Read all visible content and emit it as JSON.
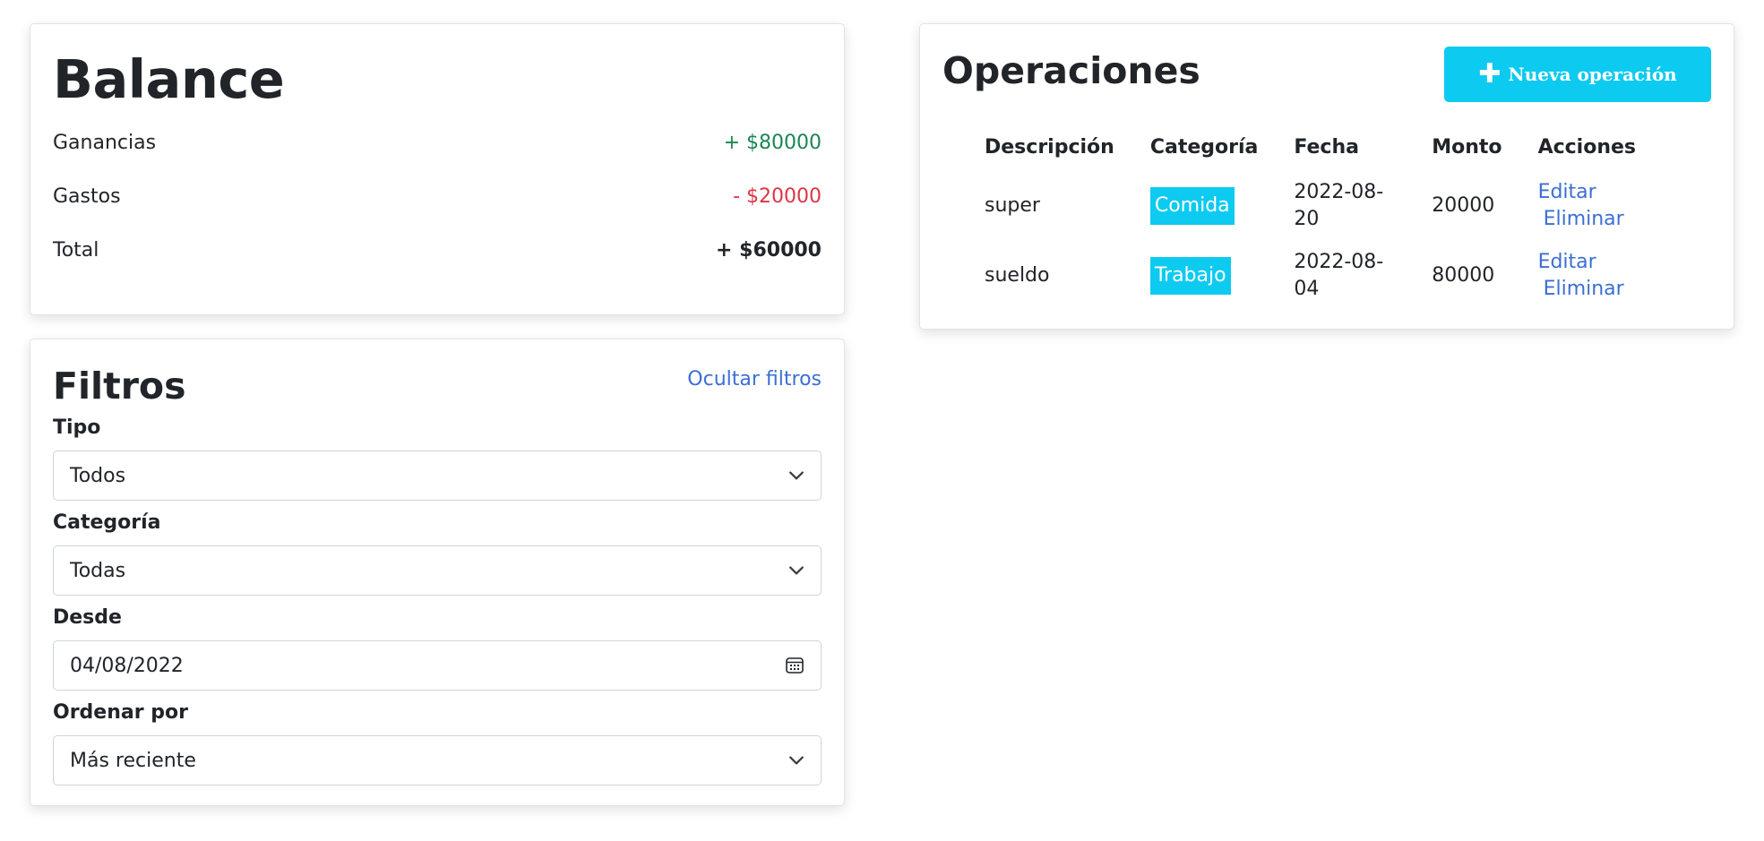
{
  "balance": {
    "title": "Balance",
    "rows": [
      {
        "label": "Ganancias",
        "value": "+ $80000"
      },
      {
        "label": "Gastos",
        "value": "- $20000"
      },
      {
        "label": "Total",
        "value": "+ $60000"
      }
    ]
  },
  "filters": {
    "title": "Filtros",
    "toggle_label": "Ocultar filtros",
    "fields": [
      {
        "label": "Tipo",
        "value": "Todos"
      },
      {
        "label": "Categoría",
        "value": "Todas"
      },
      {
        "label": "Desde",
        "value": "04/08/2022"
      },
      {
        "label": "Ordenar por",
        "value": "Más reciente"
      }
    ]
  },
  "operations": {
    "title": "Operaciones",
    "new_button_label": "Nueva operación",
    "columns": [
      "Descripción",
      "Categoría",
      "Fecha",
      "Monto",
      "Acciones"
    ],
    "rows": [
      {
        "description": "super",
        "category": "Comida",
        "date": "2022-08-20",
        "amount": "20000",
        "edit": "Editar",
        "delete": "Eliminar"
      },
      {
        "description": "sueldo",
        "category": "Trabajo",
        "date": "2022-08-04",
        "amount": "80000",
        "edit": "Editar",
        "delete": "Eliminar"
      }
    ]
  },
  "colors": {
    "accent": "#0dcaf0",
    "positive": "#198754",
    "negative": "#dc3545",
    "link": "#3b6fd4"
  },
  "icons": {
    "select_caret": "chevron-down-icon",
    "date_picker": "calendar-icon",
    "new_button": "plus-icon"
  }
}
